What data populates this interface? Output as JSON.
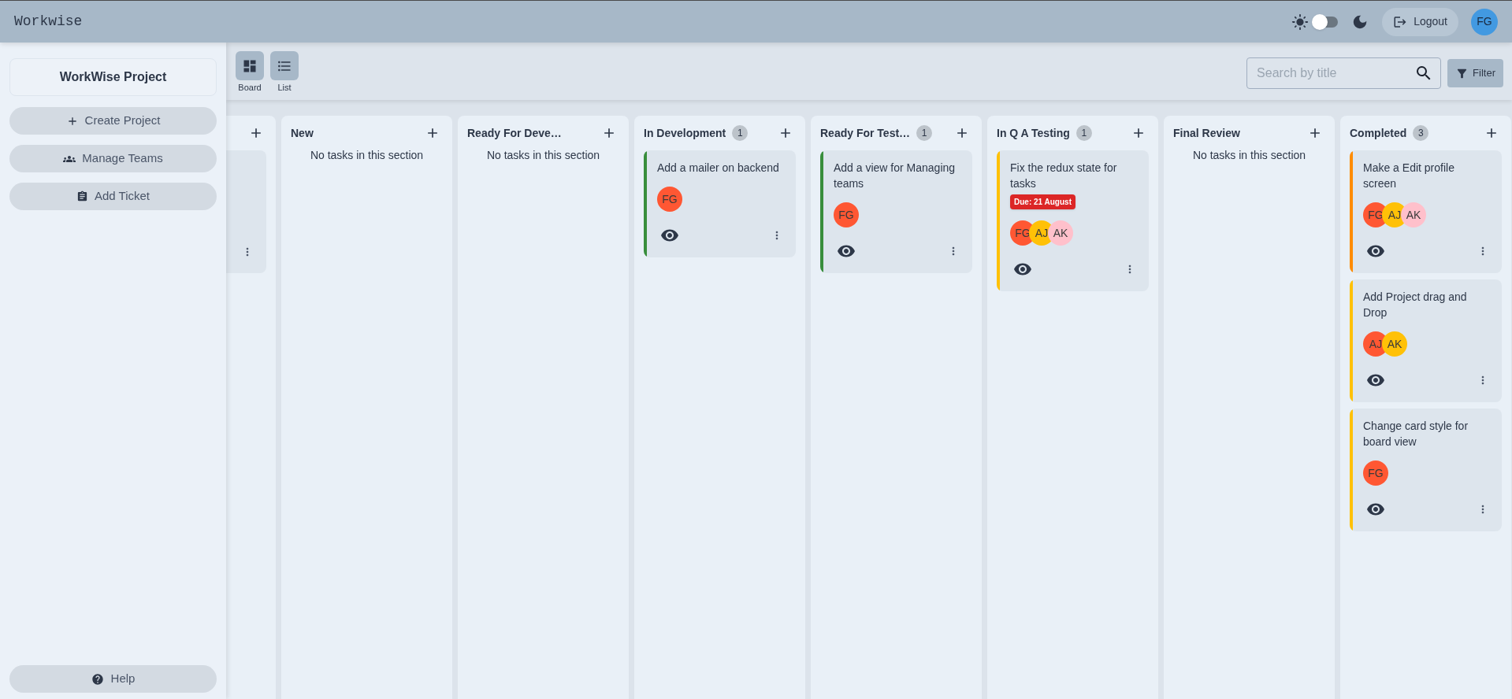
{
  "header": {
    "logo": "Workwise",
    "theme_toggle": {
      "on": false
    },
    "logout": "Logout",
    "avatar": "FG"
  },
  "sidebar": {
    "project": "WorkWise Project",
    "actions": [
      {
        "kind": "create",
        "label": "Create Project"
      },
      {
        "kind": "teams",
        "label": "Manage Teams"
      },
      {
        "kind": "ticket",
        "label": "Add Ticket"
      }
    ],
    "help": "Help"
  },
  "toolbar": {
    "views": [
      {
        "kind": "board",
        "label": "Board"
      },
      {
        "kind": "list",
        "label": "List"
      }
    ],
    "search": {
      "placeholder": "Search by title"
    },
    "filter": "Filter"
  },
  "columns": [
    {
      "kind": "clipped",
      "cards": [
        {
          "kind": "clipped"
        }
      ]
    },
    {
      "kind": "full",
      "title": "New",
      "empty_text": "No tasks in this section"
    },
    {
      "kind": "full",
      "title": "Ready For Deve…",
      "empty_text": "No tasks in this section"
    },
    {
      "kind": "full",
      "title": "In Development",
      "count": "1",
      "cards": [
        {
          "kind": "full",
          "title": "Add a mailer on backend",
          "color": "#388e3c",
          "assignees": [
            {
              "initials": "FG",
              "color": "#ff5733"
            }
          ]
        }
      ]
    },
    {
      "kind": "full",
      "title": "Ready For Test…",
      "count": "1",
      "cards": [
        {
          "kind": "full",
          "title": "Add a view for Managing teams",
          "color": "#388e3c",
          "assignees": [
            {
              "initials": "FG",
              "color": "#ff5733"
            }
          ]
        }
      ]
    },
    {
      "kind": "full",
      "title": "In Q A Testing",
      "count": "1",
      "cards": [
        {
          "kind": "full",
          "title": "Fix the redux state for tasks",
          "color": "#ffc107",
          "due": "Due: 21 August",
          "assignees": [
            {
              "initials": "FG",
              "color": "#ff5733"
            },
            {
              "initials": "AJ",
              "color": "#ffc107"
            },
            {
              "initials": "AK",
              "color": "#ffc0cb"
            }
          ]
        }
      ]
    },
    {
      "kind": "full",
      "title": "Final Review",
      "empty_text": "No tasks in this section"
    },
    {
      "kind": "full",
      "title": "Completed",
      "count": "3",
      "cards": [
        {
          "kind": "full",
          "title": "Make a Edit profile screen",
          "color": "#ff8c00",
          "assignees": [
            {
              "initials": "FG",
              "color": "#ff5733"
            },
            {
              "initials": "AJ",
              "color": "#ffc107"
            },
            {
              "initials": "AK",
              "color": "#ffc0cb"
            }
          ]
        },
        {
          "kind": "full",
          "title": "Add Project drag and Drop",
          "color": "#ffc107",
          "assignees": [
            {
              "initials": "AJ",
              "color": "#ff5733"
            },
            {
              "initials": "AK",
              "color": "#ffc107"
            }
          ]
        },
        {
          "kind": "full",
          "title": "Change card style for board view",
          "color": "#ffc107",
          "assignees": [
            {
              "initials": "FG",
              "color": "#ff5733"
            }
          ]
        }
      ]
    }
  ]
}
